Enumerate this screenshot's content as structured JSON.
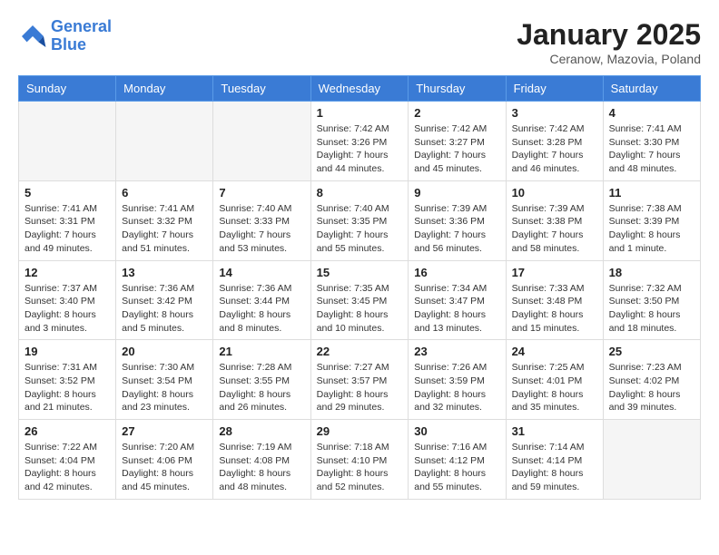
{
  "logo": {
    "line1": "General",
    "line2": "Blue"
  },
  "title": "January 2025",
  "location": "Ceranow, Mazovia, Poland",
  "weekdays": [
    "Sunday",
    "Monday",
    "Tuesday",
    "Wednesday",
    "Thursday",
    "Friday",
    "Saturday"
  ],
  "weeks": [
    [
      {
        "day": "",
        "info": ""
      },
      {
        "day": "",
        "info": ""
      },
      {
        "day": "",
        "info": ""
      },
      {
        "day": "1",
        "info": "Sunrise: 7:42 AM\nSunset: 3:26 PM\nDaylight: 7 hours and 44 minutes."
      },
      {
        "day": "2",
        "info": "Sunrise: 7:42 AM\nSunset: 3:27 PM\nDaylight: 7 hours and 45 minutes."
      },
      {
        "day": "3",
        "info": "Sunrise: 7:42 AM\nSunset: 3:28 PM\nDaylight: 7 hours and 46 minutes."
      },
      {
        "day": "4",
        "info": "Sunrise: 7:41 AM\nSunset: 3:30 PM\nDaylight: 7 hours and 48 minutes."
      }
    ],
    [
      {
        "day": "5",
        "info": "Sunrise: 7:41 AM\nSunset: 3:31 PM\nDaylight: 7 hours and 49 minutes."
      },
      {
        "day": "6",
        "info": "Sunrise: 7:41 AM\nSunset: 3:32 PM\nDaylight: 7 hours and 51 minutes."
      },
      {
        "day": "7",
        "info": "Sunrise: 7:40 AM\nSunset: 3:33 PM\nDaylight: 7 hours and 53 minutes."
      },
      {
        "day": "8",
        "info": "Sunrise: 7:40 AM\nSunset: 3:35 PM\nDaylight: 7 hours and 55 minutes."
      },
      {
        "day": "9",
        "info": "Sunrise: 7:39 AM\nSunset: 3:36 PM\nDaylight: 7 hours and 56 minutes."
      },
      {
        "day": "10",
        "info": "Sunrise: 7:39 AM\nSunset: 3:38 PM\nDaylight: 7 hours and 58 minutes."
      },
      {
        "day": "11",
        "info": "Sunrise: 7:38 AM\nSunset: 3:39 PM\nDaylight: 8 hours and 1 minute."
      }
    ],
    [
      {
        "day": "12",
        "info": "Sunrise: 7:37 AM\nSunset: 3:40 PM\nDaylight: 8 hours and 3 minutes."
      },
      {
        "day": "13",
        "info": "Sunrise: 7:36 AM\nSunset: 3:42 PM\nDaylight: 8 hours and 5 minutes."
      },
      {
        "day": "14",
        "info": "Sunrise: 7:36 AM\nSunset: 3:44 PM\nDaylight: 8 hours and 8 minutes."
      },
      {
        "day": "15",
        "info": "Sunrise: 7:35 AM\nSunset: 3:45 PM\nDaylight: 8 hours and 10 minutes."
      },
      {
        "day": "16",
        "info": "Sunrise: 7:34 AM\nSunset: 3:47 PM\nDaylight: 8 hours and 13 minutes."
      },
      {
        "day": "17",
        "info": "Sunrise: 7:33 AM\nSunset: 3:48 PM\nDaylight: 8 hours and 15 minutes."
      },
      {
        "day": "18",
        "info": "Sunrise: 7:32 AM\nSunset: 3:50 PM\nDaylight: 8 hours and 18 minutes."
      }
    ],
    [
      {
        "day": "19",
        "info": "Sunrise: 7:31 AM\nSunset: 3:52 PM\nDaylight: 8 hours and 21 minutes."
      },
      {
        "day": "20",
        "info": "Sunrise: 7:30 AM\nSunset: 3:54 PM\nDaylight: 8 hours and 23 minutes."
      },
      {
        "day": "21",
        "info": "Sunrise: 7:28 AM\nSunset: 3:55 PM\nDaylight: 8 hours and 26 minutes."
      },
      {
        "day": "22",
        "info": "Sunrise: 7:27 AM\nSunset: 3:57 PM\nDaylight: 8 hours and 29 minutes."
      },
      {
        "day": "23",
        "info": "Sunrise: 7:26 AM\nSunset: 3:59 PM\nDaylight: 8 hours and 32 minutes."
      },
      {
        "day": "24",
        "info": "Sunrise: 7:25 AM\nSunset: 4:01 PM\nDaylight: 8 hours and 35 minutes."
      },
      {
        "day": "25",
        "info": "Sunrise: 7:23 AM\nSunset: 4:02 PM\nDaylight: 8 hours and 39 minutes."
      }
    ],
    [
      {
        "day": "26",
        "info": "Sunrise: 7:22 AM\nSunset: 4:04 PM\nDaylight: 8 hours and 42 minutes."
      },
      {
        "day": "27",
        "info": "Sunrise: 7:20 AM\nSunset: 4:06 PM\nDaylight: 8 hours and 45 minutes."
      },
      {
        "day": "28",
        "info": "Sunrise: 7:19 AM\nSunset: 4:08 PM\nDaylight: 8 hours and 48 minutes."
      },
      {
        "day": "29",
        "info": "Sunrise: 7:18 AM\nSunset: 4:10 PM\nDaylight: 8 hours and 52 minutes."
      },
      {
        "day": "30",
        "info": "Sunrise: 7:16 AM\nSunset: 4:12 PM\nDaylight: 8 hours and 55 minutes."
      },
      {
        "day": "31",
        "info": "Sunrise: 7:14 AM\nSunset: 4:14 PM\nDaylight: 8 hours and 59 minutes."
      },
      {
        "day": "",
        "info": ""
      }
    ]
  ]
}
